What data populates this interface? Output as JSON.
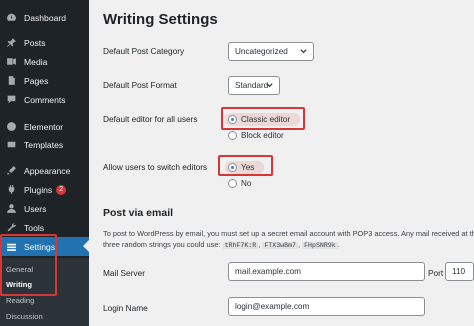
{
  "sidebar": {
    "items": [
      {
        "label": "Dashboard",
        "icon": "dashboard-icon"
      },
      {
        "label": "Posts",
        "icon": "pin-icon"
      },
      {
        "label": "Media",
        "icon": "media-icon"
      },
      {
        "label": "Pages",
        "icon": "pages-icon"
      },
      {
        "label": "Comments",
        "icon": "comments-icon"
      },
      {
        "label": "Elementor",
        "icon": "elementor-icon"
      },
      {
        "label": "Templates",
        "icon": "templates-icon"
      },
      {
        "label": "Appearance",
        "icon": "appearance-icon"
      },
      {
        "label": "Plugins",
        "icon": "plugins-icon",
        "badge": "2"
      },
      {
        "label": "Users",
        "icon": "users-icon"
      },
      {
        "label": "Tools",
        "icon": "tools-icon"
      },
      {
        "label": "Settings",
        "icon": "settings-icon",
        "current": true
      }
    ],
    "submenu": [
      {
        "label": "General"
      },
      {
        "label": "Writing",
        "current": true
      },
      {
        "label": "Reading"
      },
      {
        "label": "Discussion"
      }
    ]
  },
  "main": {
    "title": "Writing Settings",
    "default_post_category": {
      "label": "Default Post Category",
      "value": "Uncategorized"
    },
    "default_post_format": {
      "label": "Default Post Format",
      "value": "Standard"
    },
    "default_editor": {
      "label": "Default editor for all users",
      "options": [
        "Classic editor",
        "Block editor"
      ],
      "selected": "Classic editor"
    },
    "allow_switch": {
      "label": "Allow users to switch editors",
      "options": [
        "Yes",
        "No"
      ],
      "selected": "Yes"
    },
    "post_via_email": {
      "title": "Post via email",
      "desc_line1": "To post to WordPress by email, you must set up a secret email account with POP3 access. Any mail received at this",
      "desc_line2_prefix": "three random strings you could use:",
      "codes": [
        "tRhF7K:R",
        "FTX3wBm7",
        "FHpSNR9k"
      ],
      "desc_line2_suffix": "."
    },
    "mail_server": {
      "label": "Mail Server",
      "value": "mail.example.com",
      "port_label": "Port",
      "port_value": "110"
    },
    "login_name": {
      "label": "Login Name",
      "value": "login@example.com"
    }
  },
  "colors": {
    "sidebar_bg": "#1d2327",
    "accent": "#2271b1",
    "highlight": "#d63638",
    "page_bg": "#f0f0f1"
  }
}
